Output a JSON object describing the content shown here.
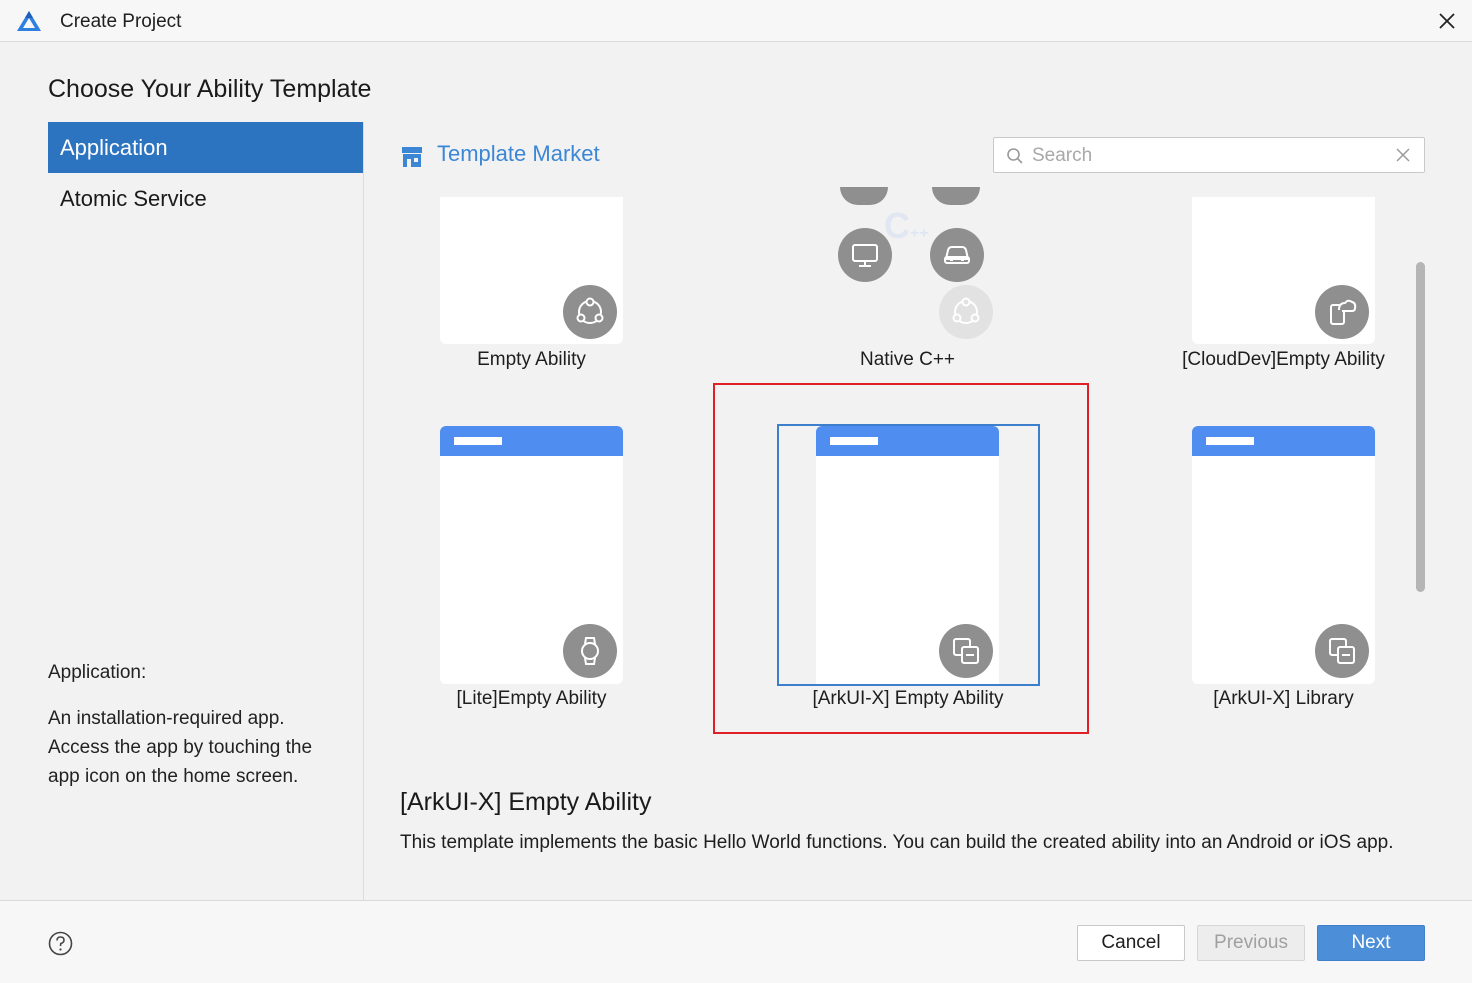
{
  "window": {
    "title": "Create Project",
    "close_icon": "close-icon",
    "logo_icon": "deveco-logo-icon"
  },
  "page": {
    "heading": "Choose Your Ability Template"
  },
  "sidebar": {
    "items": [
      {
        "label": "Application",
        "active": true
      },
      {
        "label": "Atomic Service",
        "active": false
      }
    ],
    "description": {
      "title": "Application:",
      "body": "An installation-required app. Access the app by touching the app icon on the home screen."
    }
  },
  "market": {
    "label": "Template Market",
    "icon": "store-icon"
  },
  "search": {
    "placeholder": "Search",
    "value": ""
  },
  "templates": [
    {
      "label": "Empty Ability",
      "icon": "multi-device-icon"
    },
    {
      "label": "Native C++",
      "icon": "cpp-devices-icon"
    },
    {
      "label": "[CloudDev]Empty Ability",
      "icon": "cloud-device-icon"
    },
    {
      "label": "[Lite]Empty Ability",
      "icon": "watch-icon"
    },
    {
      "label": "[ArkUI-X] Empty Ability",
      "icon": "cross-platform-icon",
      "selected": true
    },
    {
      "label": "[ArkUI-X] Library",
      "icon": "cross-platform-icon"
    }
  ],
  "detail": {
    "title": "[ArkUI-X] Empty Ability",
    "description": "This template implements the basic Hello World functions. You can build the created ability into an Android or iOS app."
  },
  "footer": {
    "help_icon": "help-icon",
    "cancel": "Cancel",
    "previous": "Previous",
    "next": "Next",
    "previous_enabled": false
  },
  "colors": {
    "accent": "#2c74c0",
    "highlight": "#e02026",
    "primary_button": "#4c8fd8",
    "template_header": "#4f8ef0"
  }
}
